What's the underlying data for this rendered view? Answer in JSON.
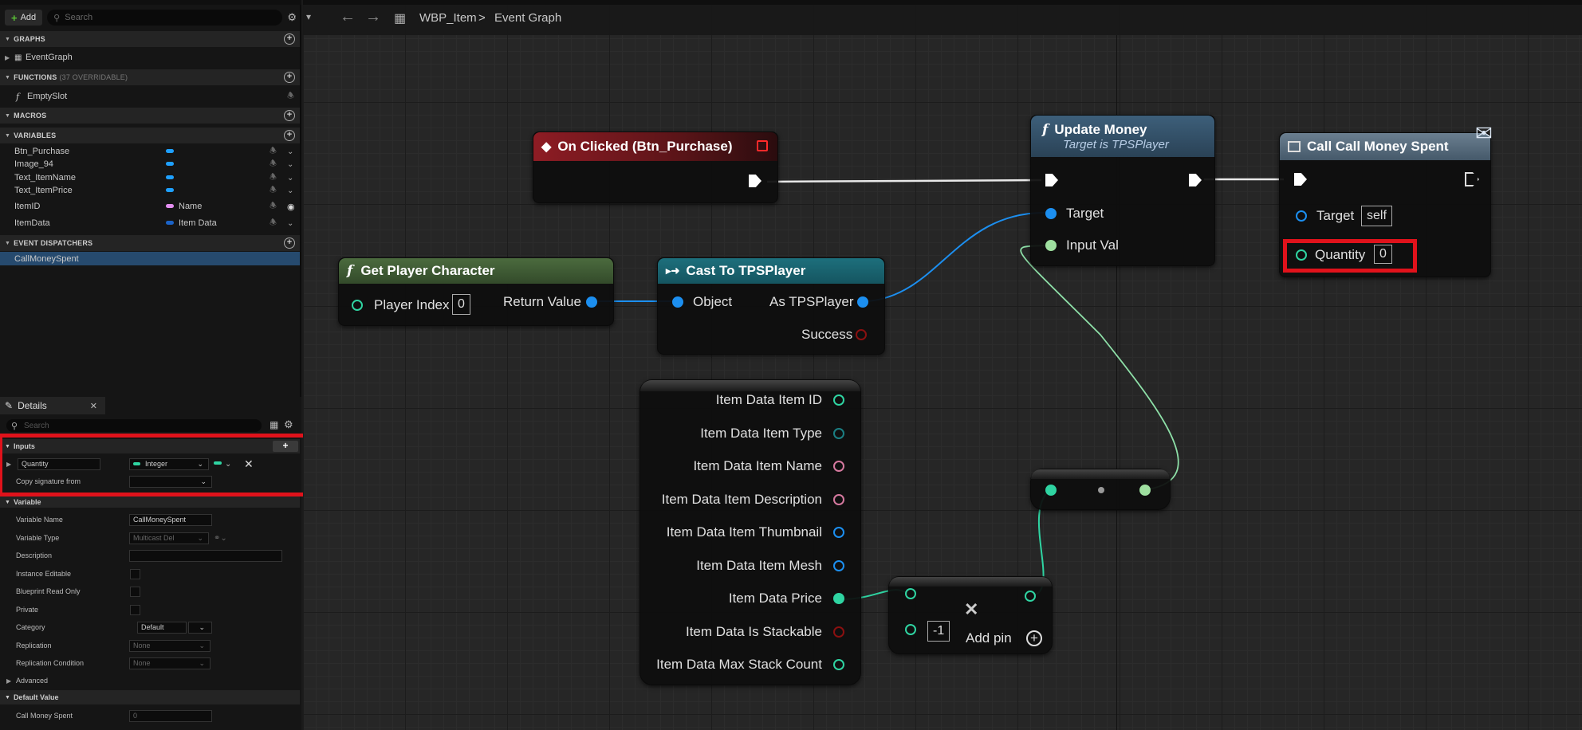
{
  "left_panel": {
    "toolbar": {
      "add_label": "Add",
      "search_placeholder": "Search"
    },
    "sections": {
      "graphs": "GRAPHS",
      "functions": "FUNCTIONS",
      "functions_note": "(37 OVERRIDABLE)",
      "macros": "MACROS",
      "variables": "VARIABLES",
      "event_dispatchers": "EVENT DISPATCHERS"
    },
    "graphs": [
      {
        "label": "EventGraph"
      }
    ],
    "functions": [
      {
        "label": "EmptySlot"
      }
    ],
    "variables": [
      {
        "name": "Btn_Purchase",
        "type": ""
      },
      {
        "name": "Image_94",
        "type": ""
      },
      {
        "name": "Text_ItemName",
        "type": ""
      },
      {
        "name": "Text_ItemPrice",
        "type": ""
      },
      {
        "name": "ItemID",
        "type": "Name"
      },
      {
        "name": "ItemData",
        "type": "Item Data"
      }
    ],
    "event_dispatchers": [
      {
        "label": "CallMoneySpent"
      }
    ]
  },
  "details": {
    "tab": "Details",
    "search_placeholder": "Search",
    "inputs_section": "Inputs",
    "input_name": "Quantity",
    "input_type": "Integer",
    "copy_signature_label": "Copy signature from",
    "variable_section": "Variable",
    "rows": {
      "variable_name_label": "Variable Name",
      "variable_name_value": "CallMoneySpent",
      "variable_type_label": "Variable Type",
      "variable_type_value": "Multicast Del",
      "description_label": "Description",
      "instance_editable_label": "Instance Editable",
      "read_only_label": "Blueprint Read Only",
      "private_label": "Private",
      "category_label": "Category",
      "category_value": "Default",
      "replication_label": "Replication",
      "replication_value": "None",
      "replication_condition_label": "Replication Condition",
      "replication_condition_value": "None"
    },
    "advanced_label": "Advanced",
    "default_value_section": "Default Value",
    "default_row_label": "Call Money Spent",
    "default_row_value": "0"
  },
  "graph": {
    "breadcrumb": {
      "asset": "WBP_Item",
      "graph": "Event Graph"
    },
    "nodes": {
      "on_clicked": {
        "title": "On Clicked (Btn_Purchase)"
      },
      "update_money": {
        "title": "Update Money",
        "subtitle": "Target is TPSPlayer",
        "pin_target": "Target",
        "pin_input": "Input Val"
      },
      "call_money": {
        "title": "Call Call Money Spent",
        "pin_target": "Target",
        "target_value": "self",
        "pin_quantity": "Quantity",
        "quantity_value": "0"
      },
      "get_player": {
        "title": "Get Player Character",
        "pin_index": "Player Index",
        "index_value": "0",
        "pin_return": "Return Value"
      },
      "cast": {
        "title": "Cast To TPSPlayer",
        "pin_object": "Object",
        "pin_as": "As TPSPlayer",
        "pin_success": "Success"
      },
      "break_item": {
        "pins": [
          "Item Data Item ID",
          "Item Data Item Type",
          "Item Data Item Name",
          "Item Data Item Description",
          "Item Data Item Thumbnail",
          "Item Data Item Mesh",
          "Item Data Price",
          "Item Data Is Stackable",
          "Item Data Max Stack Count"
        ]
      },
      "multiply": {
        "value": "-1",
        "add_pin": "Add pin"
      }
    }
  },
  "colors": {
    "highlight": "#e0121b",
    "event_header": "#8e1c24",
    "function_header": "#3d5f7a",
    "pure_header": "#4b6b3e",
    "cast_header": "#1d6f7c"
  }
}
